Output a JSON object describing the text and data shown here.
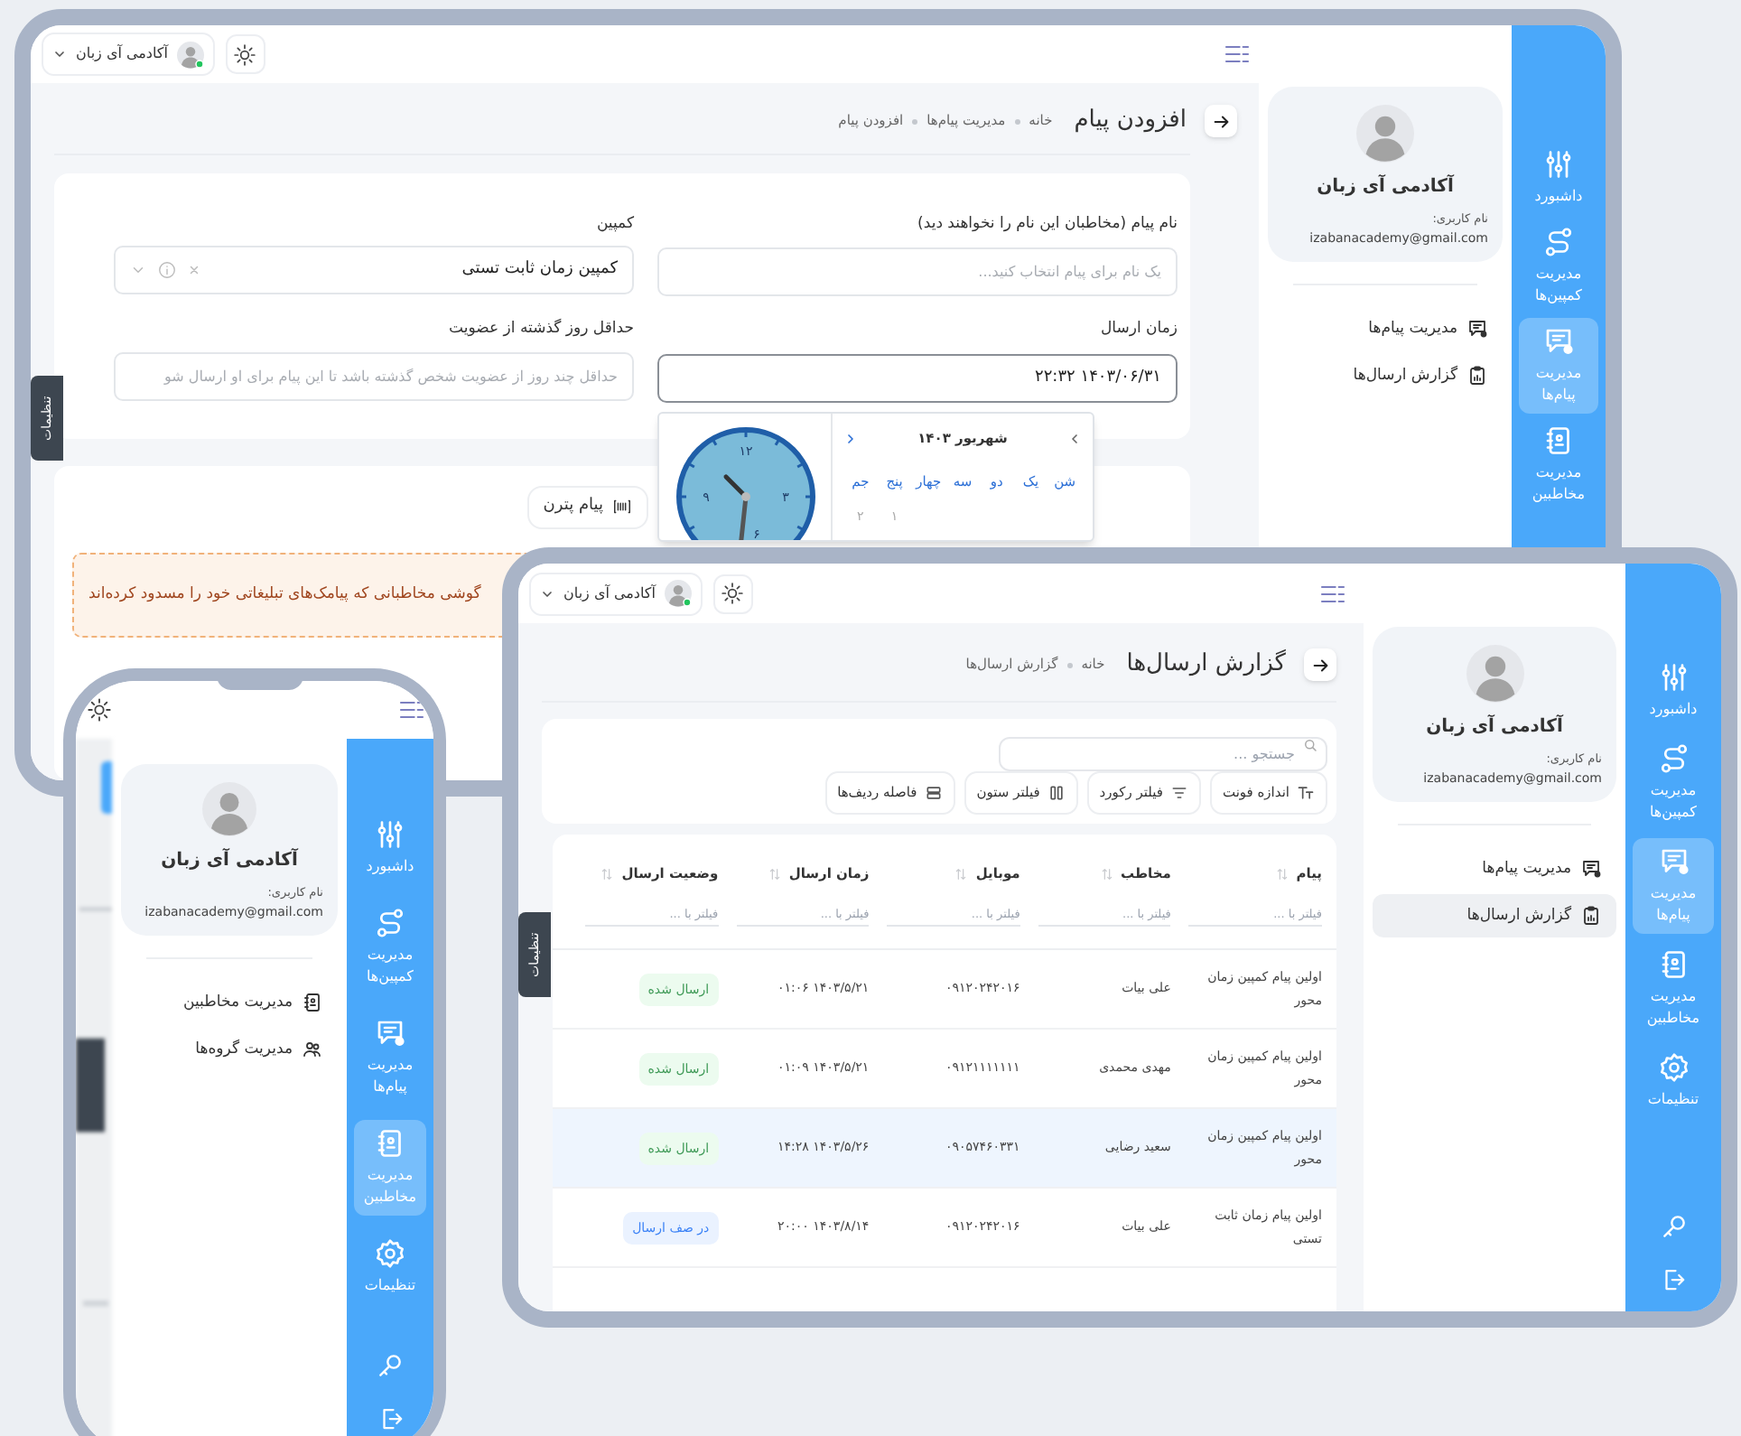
{
  "devices": [
    {
      "kind": "laptop",
      "topbar": {
        "user": "آکادمی آی زبان"
      },
      "sidebar": [
        {
          "label": "داشبورد",
          "selected": false
        },
        {
          "label": "مدیریت کمپین‌ها",
          "selected": false
        },
        {
          "label": "مدیریت پیام‌ها",
          "selected": true
        },
        {
          "label": "مدیریت مخاطبین",
          "selected": false
        }
      ],
      "profile": {
        "name": "آکادمی آی زبان",
        "username_label": "نام کاربری:",
        "email": "izabanacademy@gmail.com"
      },
      "submenu": [
        {
          "label": "مدیریت پیام‌ها",
          "selected": false
        },
        {
          "label": "گزارش ارسال‌ها",
          "selected": false
        }
      ],
      "side_tab": "تنظیمات",
      "page": {
        "title": "افزودن پیام",
        "breadcrumb": [
          "خانه",
          "مدیریت پیام‌ها",
          "افزودن پیام"
        ],
        "fields": [
          {
            "kind": "text",
            "label": "نام پیام (مخاطبان این نام را نخواهند دید)",
            "placeholder": "یک نام برای پیام انتخاب کنید...",
            "focused": false
          },
          {
            "kind": "select",
            "label": "کمپین",
            "value": "کمپین زمان ثابت تستی",
            "focused": false
          },
          {
            "kind": "datetime",
            "label": "زمان ارسال",
            "value": "۱۴۰۳/۰۶/۳۱ ۲۲:۳۲",
            "focused": true,
            "calendar": {
              "month": "شهریور ۱۴۰۳",
              "weekdays": [
                "شن",
                "یک",
                "دو",
                "سه",
                "چهار",
                "پنج",
                "جم"
              ],
              "first_week": [
                "۱",
                "۲"
              ]
            },
            "clock": {
              "numerals": [
                "۱۲",
                "۳",
                "۶",
                "۹"
              ]
            }
          },
          {
            "kind": "text",
            "label": "حداقل روز گذشته از عضویت",
            "placeholder": "حداقل چند روز از عضویت شخص گذشته باشد تا این پیام برای او ارسال شو",
            "focused": false
          }
        ],
        "tabs": [
          {
            "label": "پیام پترن",
            "selected": false
          }
        ],
        "alert": "گوشی مخاطبانی که پیامک‌های تبلیغاتی خود را مسدود کرده‌اند"
      }
    },
    {
      "kind": "phone",
      "sidebar": [
        {
          "label": "داشبورد",
          "selected": false
        },
        {
          "label": "مدیریت کمپین‌ها",
          "selected": false
        },
        {
          "label": "مدیریت پیام‌ها",
          "selected": false
        },
        {
          "label": "مدیریت مخاطبین",
          "selected": true
        },
        {
          "label": "تنظیمات",
          "selected": false
        }
      ],
      "profile": {
        "name": "آکادمی آی زبان",
        "username_label": "نام کاربری:",
        "email": "izabanacademy@gmail.com"
      },
      "submenu": [
        {
          "label": "مدیریت مخاطبین",
          "selected": false
        },
        {
          "label": "مدیریت گروه‌ها",
          "selected": false
        }
      ]
    },
    {
      "kind": "tablet",
      "topbar": {
        "user": "آکادمی آی زبان"
      },
      "sidebar": [
        {
          "label": "داشبورد",
          "selected": false
        },
        {
          "label": "مدیریت کمپین‌ها",
          "selected": false
        },
        {
          "label": "مدیریت پیام‌ها",
          "selected": true
        },
        {
          "label": "مدیریت مخاطبین",
          "selected": false
        },
        {
          "label": "تنظیمات",
          "selected": false
        }
      ],
      "profile": {
        "name": "آکادمی آی زبان",
        "username_label": "نام کاربری:",
        "email": "izabanacademy@gmail.com"
      },
      "submenu": [
        {
          "label": "مدیریت پیام‌ها",
          "selected": false
        },
        {
          "label": "گزارش ارسال‌ها",
          "selected": true
        }
      ],
      "side_tab": "تنظیمات",
      "page": {
        "title": "گزارش ارسال‌ها",
        "breadcrumb": [
          "خانه",
          "گزارش ارسال‌ها"
        ],
        "search": {
          "placeholder": "جستجو ..."
        },
        "toolbar": [
          "اندازه فونت",
          "فیلتر رکورد",
          "فیلتر ستون",
          "فاصله ردیف‌ها"
        ],
        "table": {
          "columns": [
            {
              "label": "پیام",
              "filter_placeholder": "فیلتر با ..."
            },
            {
              "label": "مخاطب",
              "filter_placeholder": "فیلتر با ..."
            },
            {
              "label": "موبایل",
              "filter_placeholder": "فیلتر با ..."
            },
            {
              "label": "زمان ارسال",
              "filter_placeholder": "فیلتر با ..."
            },
            {
              "label": "وضعیت ارسال",
              "filter_placeholder": "فیلتر با ..."
            }
          ],
          "rows": [
            {
              "selected": false,
              "cells": [
                "اولین پیام کمپین زمان محور",
                "علی بیات",
                "۰۹۱۲۰۲۴۲۰۱۶",
                "۱۴۰۳/۵/۲۱ ۰۱:۰۶"
              ],
              "status": {
                "kind": "sent",
                "label": "ارسال شده"
              }
            },
            {
              "selected": false,
              "cells": [
                "اولین پیام کمپین زمان محور",
                "مهدی محمدی",
                "۰۹۱۲۱۱۱۱۱۱۱",
                "۱۴۰۳/۵/۲۱ ۰۱:۰۹"
              ],
              "status": {
                "kind": "sent",
                "label": "ارسال شده"
              }
            },
            {
              "selected": true,
              "cells": [
                "اولین پیام کمپین زمان محور",
                "سعید رضایی",
                "۰۹۰۵۷۴۶۰۳۳۱",
                "۱۴۰۳/۵/۲۶ ۱۴:۲۸"
              ],
              "status": {
                "kind": "sent",
                "label": "ارسال شده"
              }
            },
            {
              "selected": false,
              "cells": [
                "اولین پیام زمان ثابت تستی",
                "علی بیات",
                "۰۹۱۲۰۲۴۲۰۱۶",
                "۱۴۰۳/۸/۱۴ ۲۰:۰۰"
              ],
              "status": {
                "kind": "queued",
                "label": "در صف ارسال"
              }
            }
          ]
        }
      }
    }
  ]
}
